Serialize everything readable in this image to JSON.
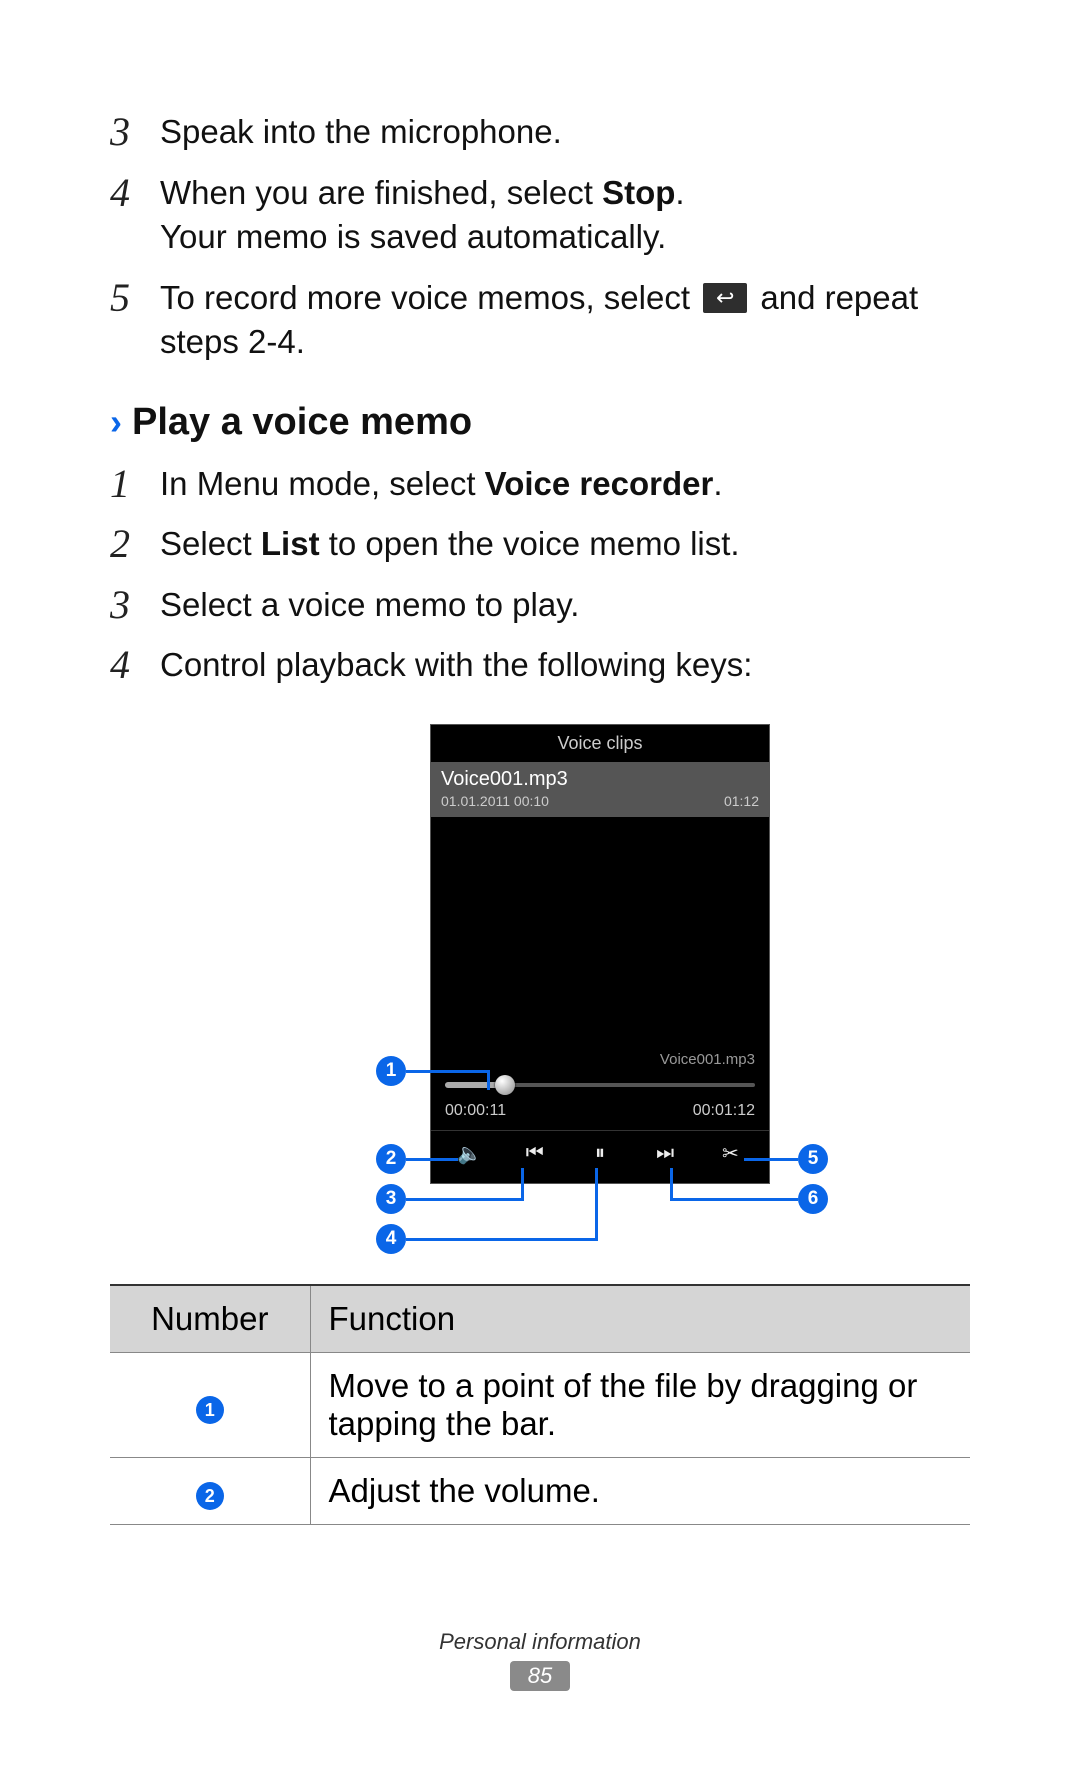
{
  "top_steps": [
    {
      "num": "3",
      "lines": [
        "Speak into the microphone."
      ]
    },
    {
      "num": "4",
      "lines_html": [
        [
          "When you are finished, select ",
          {
            "bold": "Stop"
          },
          "."
        ],
        [
          "Your memo is saved automatically."
        ]
      ]
    },
    {
      "num": "5",
      "lines_html": [
        [
          "To record more voice memos, select ",
          {
            "icon": "↩"
          },
          " and repeat steps 2-4."
        ]
      ]
    }
  ],
  "section": {
    "chevron": "›",
    "title": "Play a voice memo"
  },
  "play_steps": [
    {
      "num": "1",
      "lines_html": [
        [
          "In Menu mode, select ",
          {
            "bold": "Voice recorder"
          },
          "."
        ]
      ]
    },
    {
      "num": "2",
      "lines_html": [
        [
          "Select ",
          {
            "bold": "List"
          },
          " to open the voice memo list."
        ]
      ]
    },
    {
      "num": "3",
      "lines": [
        "Select a voice memo to play."
      ]
    },
    {
      "num": "4",
      "lines": [
        "Control playback with the following keys:"
      ]
    }
  ],
  "phone": {
    "header": "Voice clips",
    "clip_title": "Voice001.mp3",
    "clip_date": "01.01.2011 00:10",
    "clip_dur": "01:12",
    "now_playing": "Voice001.mp3",
    "elapsed": "00:00:11",
    "total": "00:01:12",
    "controls": {
      "volume": "🔈",
      "prev": "⏮",
      "pause": "⏸",
      "next": "⏭",
      "trim": "✂"
    }
  },
  "callouts": [
    "1",
    "2",
    "3",
    "4",
    "5",
    "6"
  ],
  "table": {
    "headers": [
      "Number",
      "Function"
    ],
    "rows": [
      {
        "n": "1",
        "fn": "Move to a point of the file by dragging or tapping the bar."
      },
      {
        "n": "2",
        "fn": "Adjust the volume."
      }
    ]
  },
  "footer": {
    "section": "Personal information",
    "page": "85"
  }
}
